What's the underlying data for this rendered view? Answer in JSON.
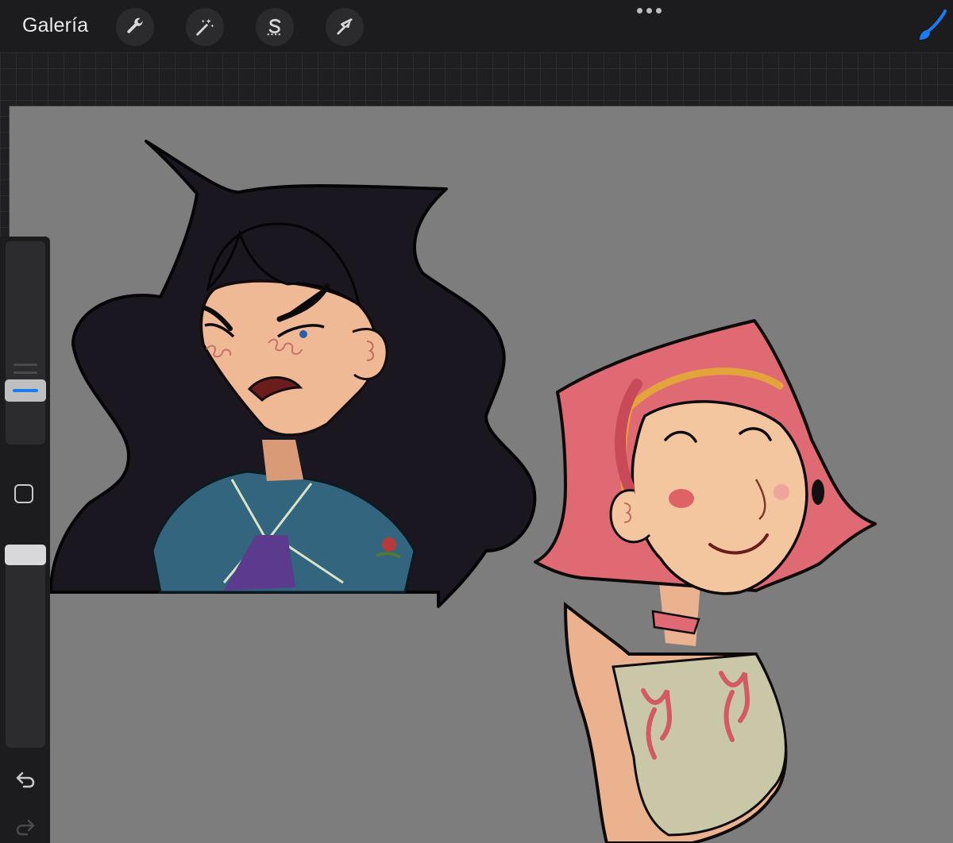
{
  "toolbar": {
    "gallery_label": "Galería",
    "tools": [
      {
        "name": "actions",
        "icon": "wrench-icon"
      },
      {
        "name": "adjustments",
        "icon": "magic-wand-icon"
      },
      {
        "name": "selection",
        "icon": "selection-s-icon"
      },
      {
        "name": "transform",
        "icon": "arrow-cursor-icon"
      }
    ],
    "more_icon": "ellipsis-icon",
    "active_tool_icon": "brush-icon",
    "accent_color": "#1a7cf4"
  },
  "sidebar": {
    "brush_size_icon": "size-slider",
    "modify_icon": "square-icon",
    "opacity_icon": "opacity-slider",
    "undo_icon": "undo-icon",
    "redo_icon": "redo-icon"
  },
  "canvas": {
    "background_color": "#7d7d7e",
    "artwork": [
      "black-haired-girl-illustration",
      "pink-haired-girl-illustration"
    ]
  }
}
